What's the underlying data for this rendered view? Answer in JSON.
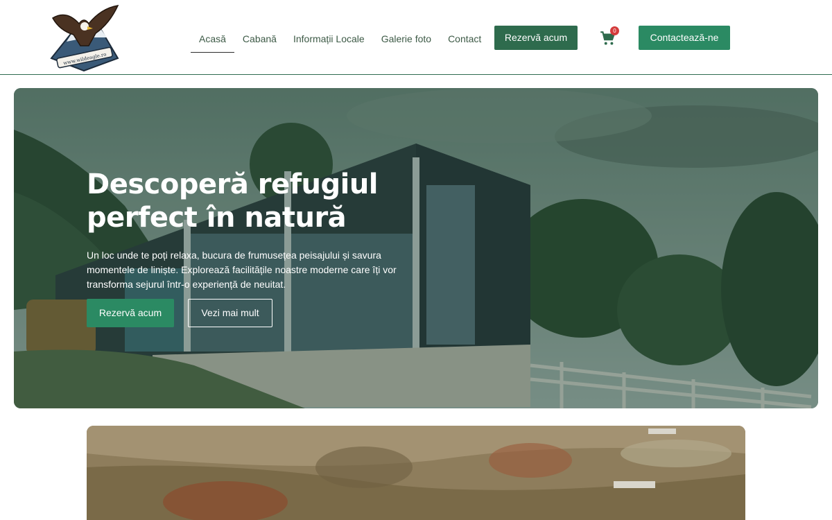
{
  "header": {
    "logo_text": "www.wildeagle.ro",
    "nav": [
      {
        "label": "Acasă",
        "active": true
      },
      {
        "label": "Cabană",
        "active": false
      },
      {
        "label": "Informații Locale",
        "active": false
      },
      {
        "label": "Galerie foto",
        "active": false
      },
      {
        "label": "Contact",
        "active": false
      }
    ],
    "reserve_label": "Rezervă acum",
    "cart_count": "0",
    "contact_label": "Contactează-ne",
    "icons": {
      "cart": "cart-icon",
      "logo": "eagle-logo"
    }
  },
  "hero": {
    "title": "Descoperă refugiul perfect în natură",
    "text": "Un loc unde te poți relaxa, bucura de frumusețea peisajului și savura momentele de liniște. Explorează facilitățile noastre moderne care îți vor transforma sejurul într-o experiență de neuitat.",
    "primary_label": "Rezervă acum",
    "secondary_label": "Vezi mai mult"
  },
  "colors": {
    "primary": "#2e6b4d",
    "accent": "#2b8a63",
    "badge": "#d43c3c"
  }
}
